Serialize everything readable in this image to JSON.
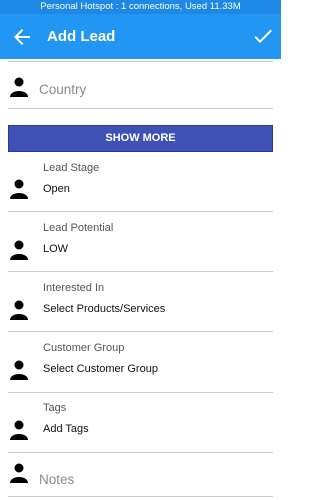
{
  "status_bar": {
    "text": "Personal Hotspot : 1 connections, Used 11.33M"
  },
  "app_bar": {
    "title": "Add Lead"
  },
  "country": {
    "placeholder": "Country"
  },
  "show_more": {
    "label": "SHOW MORE"
  },
  "lead_stage": {
    "label": "Lead Stage",
    "value": "Open"
  },
  "lead_potential": {
    "label": "Lead Potential",
    "value": "LOW"
  },
  "interested_in": {
    "label": "Interested In",
    "value": "Select Products/Services"
  },
  "customer_group": {
    "label": "Customer Group",
    "value": "Select Customer Group"
  },
  "tags": {
    "label": "Tags",
    "value": "Add Tags"
  },
  "notes": {
    "placeholder": "Notes"
  },
  "colors": {
    "app_bar": "#2196f3",
    "status_bar": "#1e88e5",
    "show_more": "#3f51b5"
  }
}
